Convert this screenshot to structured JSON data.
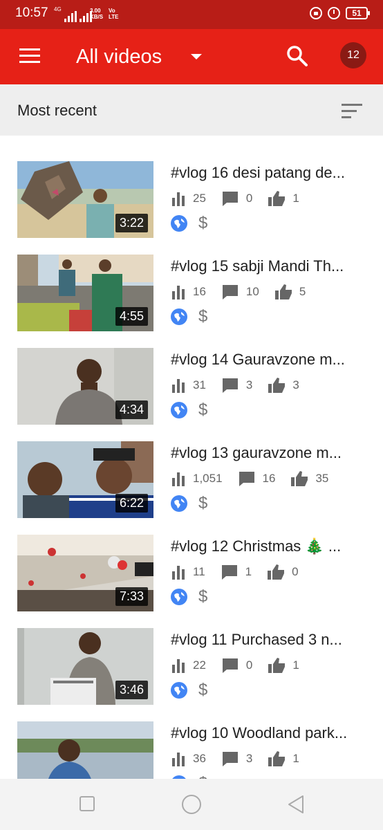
{
  "status_bar": {
    "time": "10:57",
    "signal_label": "4G",
    "speed_value": "3.00",
    "speed_unit": "KB/S",
    "volte_top": "Vo",
    "volte_bottom": "LTE",
    "battery": "51"
  },
  "app_bar": {
    "filter_label": "All videos",
    "avatar_text": "12"
  },
  "sort_bar": {
    "label": "Most recent"
  },
  "videos": [
    {
      "title": "#vlog 16 desi patang de...",
      "duration": "3:22",
      "views": "25",
      "comments": "0",
      "likes": "1"
    },
    {
      "title": "#vlog 15 sabji Mandi Th...",
      "duration": "4:55",
      "views": "16",
      "comments": "10",
      "likes": "5"
    },
    {
      "title": "#vlog 14 Gauravzone m...",
      "duration": "4:34",
      "views": "31",
      "comments": "3",
      "likes": "3"
    },
    {
      "title": "#vlog 13 gauravzone m...",
      "duration": "6:22",
      "views": "1,051",
      "comments": "16",
      "likes": "35"
    },
    {
      "title": "#vlog 12  Christmas 🎄 ...",
      "duration": "7:33",
      "views": "11",
      "comments": "1",
      "likes": "0"
    },
    {
      "title": "#vlog 11 Purchased  3 n...",
      "duration": "3:46",
      "views": "22",
      "comments": "0",
      "likes": "1"
    },
    {
      "title": "#vlog 10 Woodland park...",
      "duration": "",
      "views": "36",
      "comments": "3",
      "likes": "1"
    }
  ],
  "icons": {
    "menu": "menu-icon",
    "search": "search-icon",
    "sort": "sort-icon",
    "views": "bar-chart-icon",
    "comments": "comment-icon",
    "likes": "thumbs-up-icon",
    "visibility": "globe-icon",
    "monetization": "dollar-icon"
  },
  "colors": {
    "app_bar": "#e62117",
    "status_bar": "#b81d17",
    "globe": "#4285f4"
  }
}
